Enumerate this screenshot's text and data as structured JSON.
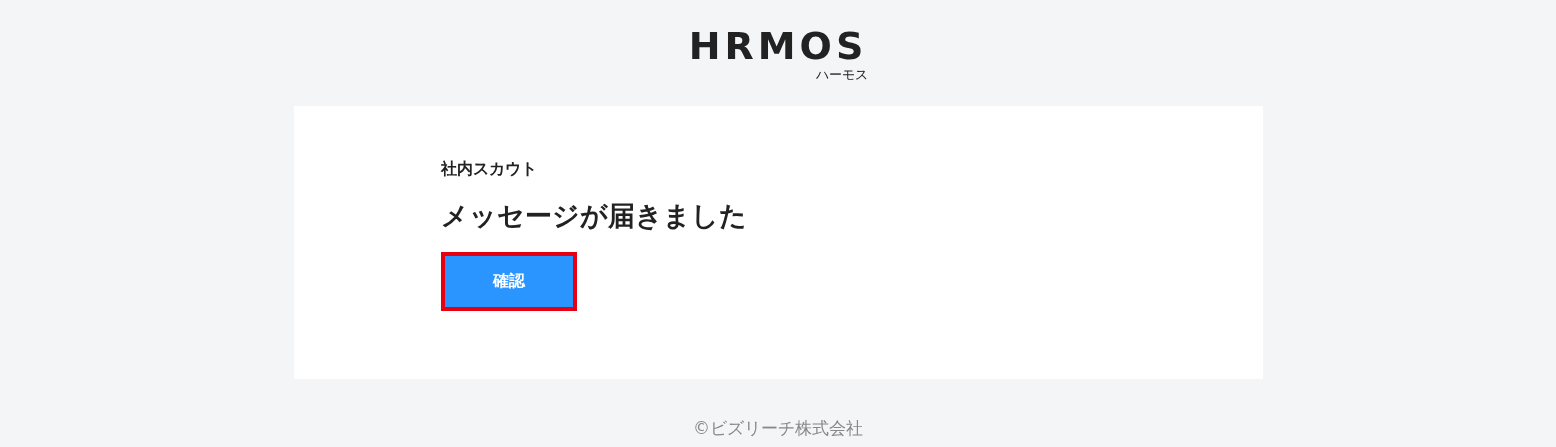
{
  "logo": {
    "wordmark": "HRMOS",
    "reading": "ハーモス"
  },
  "card": {
    "label": "社内スカウト",
    "heading": "メッセージが届きました",
    "button": {
      "label": "確認",
      "highlighted": true
    }
  },
  "footer": "©ビズリーチ株式会社"
}
